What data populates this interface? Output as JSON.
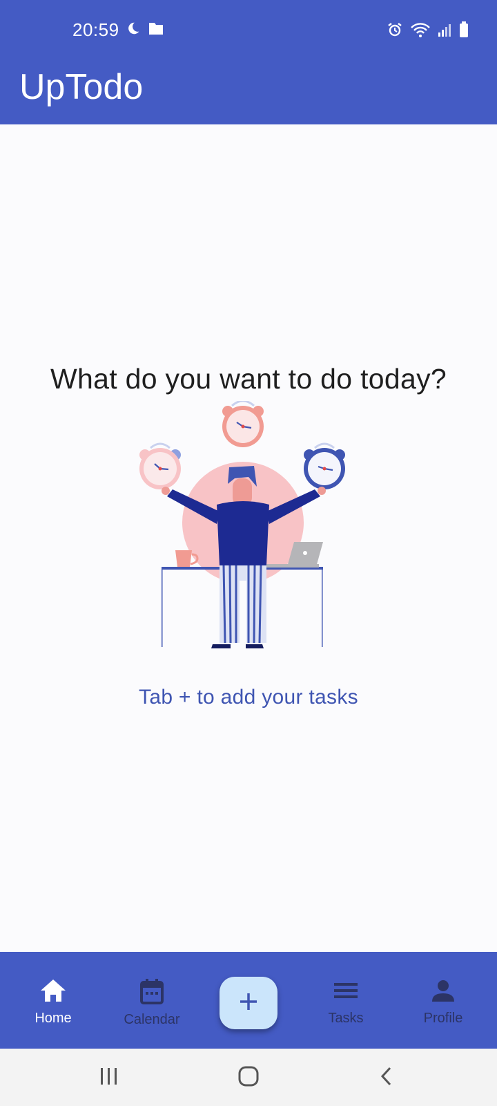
{
  "status_bar": {
    "time": "20:59",
    "icons_left": [
      "moon-icon",
      "folder-icon"
    ],
    "icons_right": [
      "alarm-icon",
      "wifi-icon",
      "signal-icon",
      "battery-icon"
    ]
  },
  "app_bar": {
    "title": "UpTodo"
  },
  "empty_state": {
    "headline": "What do you want to do today?",
    "illustration": "person-juggling-clocks-illustration",
    "hint": "Tab + to add your tasks"
  },
  "bottom_nav": {
    "items": [
      {
        "label": "Home",
        "icon": "home-icon",
        "active": true
      },
      {
        "label": "Calendar",
        "icon": "calendar-icon",
        "active": false
      },
      {
        "label": "Tasks",
        "icon": "menu-icon",
        "active": false
      },
      {
        "label": "Profile",
        "icon": "person-icon",
        "active": false
      }
    ],
    "fab_icon": "plus-icon"
  },
  "system_nav": {
    "buttons": [
      "recents-icon",
      "home-circle-icon",
      "back-icon"
    ]
  },
  "colors": {
    "primary": "#445bc4",
    "fab": "#cbe5fb",
    "hint_text": "#3f55b2",
    "background": "#fbfbfd"
  }
}
